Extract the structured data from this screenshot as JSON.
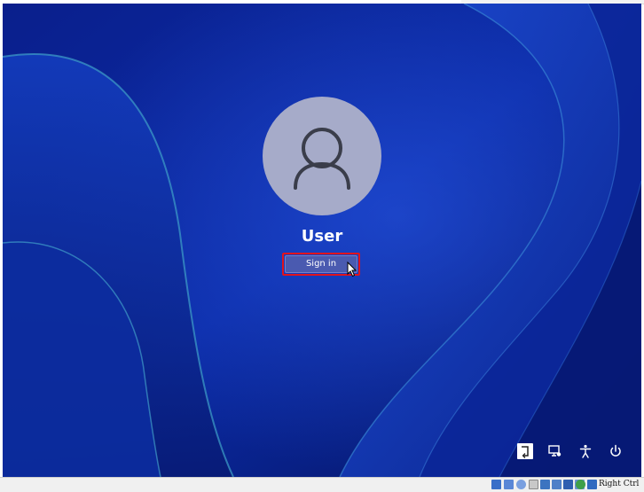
{
  "lock_screen": {
    "user_name": "User",
    "sign_in_label": "Sign in"
  },
  "corner_buttons": [
    {
      "name": "input-language-icon"
    },
    {
      "name": "network-icon"
    },
    {
      "name": "accessibility-icon"
    },
    {
      "name": "power-icon"
    }
  ],
  "host_statusbar": {
    "host_key_label": "Right Ctrl",
    "tray_icons": [
      "hard-disk-icon",
      "optical-drive-icon",
      "audio-icon",
      "network-adapter-icon",
      "usb-icon",
      "shared-folders-icon",
      "display-icon",
      "recording-icon",
      "cpu-icon",
      "mouse-integration-icon",
      "host-key-arrow-icon"
    ]
  },
  "colors": {
    "wallpaper_base": "#0a2a9a",
    "avatar_bg": "#a6abc9",
    "sign_in_button": "#4a5ab0",
    "highlight_border": "#e0141e"
  }
}
